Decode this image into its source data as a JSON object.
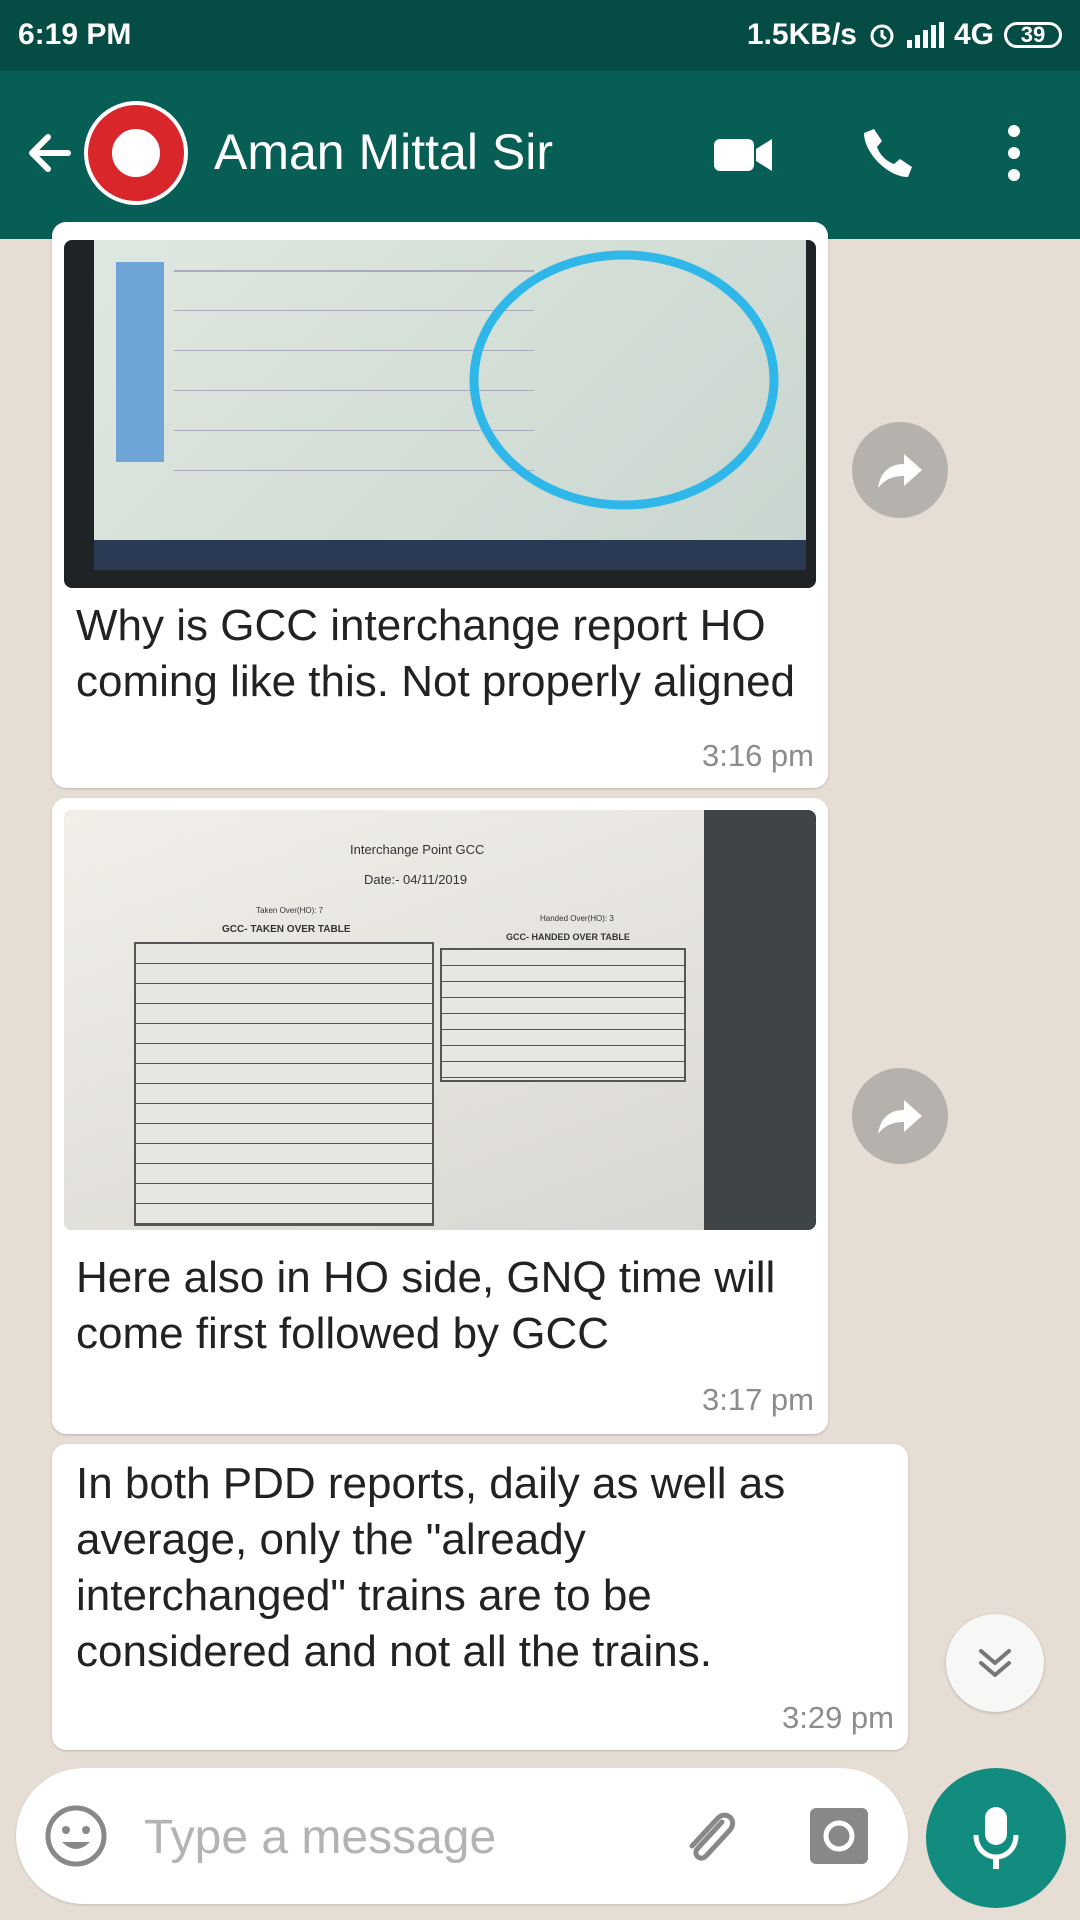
{
  "status_bar": {
    "time": "6:19 PM",
    "net_speed": "1.5KB/s",
    "network": "4G",
    "battery": "39"
  },
  "header": {
    "contact_name": "Aman Mittal Sir",
    "icons": [
      "back-arrow-icon",
      "indian-railways-logo",
      "video-call-icon",
      "phone-icon",
      "more-vert-icon"
    ]
  },
  "messages": [
    {
      "type": "image",
      "caption": "Why is GCC interchange report HO coming like this. Not properly aligned",
      "time": "3:16 pm"
    },
    {
      "type": "image",
      "caption": "Here also in HO side, GNQ time will come first followed by GCC",
      "time": "3:17 pm",
      "photo": {
        "doc_title": "Interchange Point GCC",
        "doc_date": "Date:- 04/11/2019",
        "taken_over_count": "Taken Over(HO): 7",
        "handed_over_count": "Handed Over(HO): 3",
        "left_table_title": "GCC- TAKEN OVER TABLE",
        "right_table_title": "GCC- HANDED OVER TABLE"
      }
    },
    {
      "type": "text",
      "text": "In both PDD reports, daily as well as average, only the \"already interchanged\" trains are to be considered and not all the trains.",
      "time": "3:29 pm"
    }
  ],
  "composer": {
    "placeholder": "Type a message"
  },
  "colors": {
    "header": "#075e54",
    "status_bar": "#054d44",
    "accent": "#128c7e",
    "chat_bg": "#e6ddd4"
  }
}
